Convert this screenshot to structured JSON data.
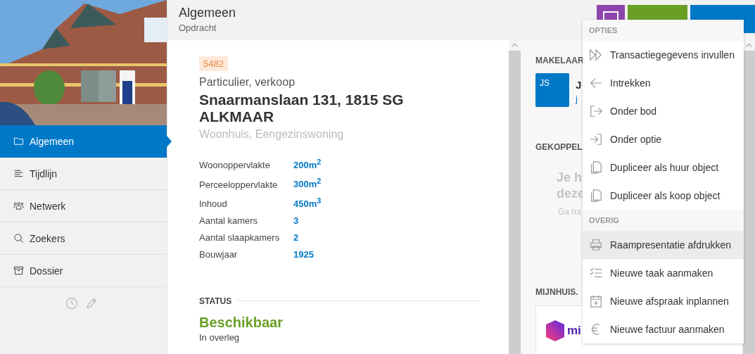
{
  "header": {
    "title": "Algemeen",
    "subtitle": "Opdracht"
  },
  "toolbar": {
    "buttons": [
      {
        "kind": "icon"
      },
      {
        "kind": "edit"
      },
      {
        "kind": "menu"
      }
    ]
  },
  "sidebar": {
    "items": [
      {
        "label": "Algemeen",
        "kind": "folder",
        "selected": true
      },
      {
        "label": "Tijdlijn",
        "kind": "timeline",
        "selected": false
      },
      {
        "label": "Netwerk",
        "kind": "people",
        "selected": false
      },
      {
        "label": "Zoekers",
        "kind": "search",
        "selected": false
      },
      {
        "label": "Dossier",
        "kind": "archive",
        "selected": false
      }
    ]
  },
  "property": {
    "id": "5482",
    "type": "Particulier, verkoop",
    "address": "Snaarmanslaan 131, 1815 SG ALKMAAR",
    "category": "Woonhuis, Eengezinswoning",
    "specs": [
      {
        "label": "Woonoppervlakte",
        "value": "200m$^{2}$"
      },
      {
        "label": "Perceeloppervlakte",
        "value": "300m$^{2}$"
      },
      {
        "label": "Inhoud",
        "value": "450m$^{3}$"
      },
      {
        "label": "Aantal kamers",
        "value": "3"
      },
      {
        "label": "Aantal slaapkamers",
        "value": "2"
      },
      {
        "label": "Bouwjaar",
        "value": "1925"
      }
    ],
    "status_heading": "STATUS",
    "status": "Beschikbaar",
    "substatus": "In overleg"
  },
  "side_panel": {
    "agent_heading": "MAKELAAR",
    "agent_initials": "JS",
    "agent_name": "J",
    "agent_email": "j",
    "linked_heading": "GEKOPPEL",
    "empty_line_1": "Je h",
    "empty_line_2": "deze",
    "empty_hint": "Ga na",
    "mijnhuis_heading": "MIJNHUIS.",
    "mijnhuis_logo_text": "mi"
  },
  "menu": {
    "sections": [
      {
        "heading": "OPTIES",
        "items": [
          {
            "label": "Transactiegegevens invullen",
            "kind": "forward",
            "selected": false
          },
          {
            "label": "Intrekken",
            "kind": "back",
            "selected": false
          },
          {
            "label": "Onder bod",
            "kind": "exit",
            "selected": false
          },
          {
            "label": "Onder optie",
            "kind": "enter",
            "selected": false
          },
          {
            "label": "Dupliceer als huur object",
            "kind": "copy",
            "selected": false
          },
          {
            "label": "Dupliceer als koop object",
            "kind": "copy",
            "selected": false
          }
        ]
      },
      {
        "heading": "OVERIG",
        "items": [
          {
            "label": "Raampresentatie afdrukken",
            "kind": "print",
            "selected": true
          },
          {
            "label": "Nieuwe taak aanmaken",
            "kind": "tasks",
            "selected": false
          },
          {
            "label": "Nieuwe afspraak inplannen",
            "kind": "calendar",
            "selected": false
          },
          {
            "label": "Nieuwe factuur aanmaken",
            "kind": "euro",
            "selected": false
          }
        ]
      }
    ]
  }
}
